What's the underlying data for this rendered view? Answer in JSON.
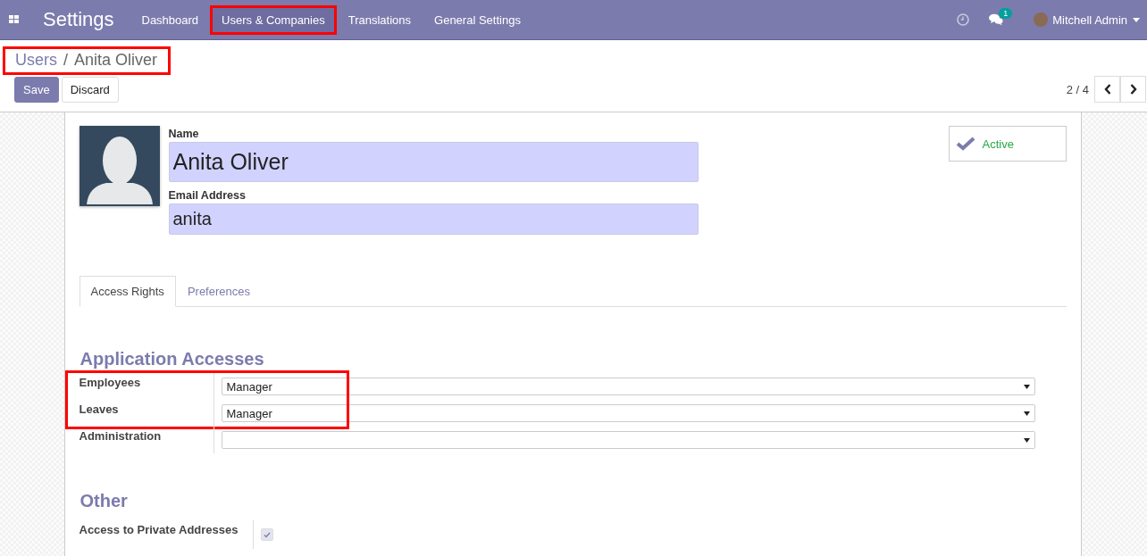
{
  "navbar": {
    "app_title": "Settings",
    "menu": [
      {
        "label": "Dashboard",
        "highlighted": false
      },
      {
        "label": "Users & Companies",
        "highlighted": true
      },
      {
        "label": "Translations",
        "highlighted": false
      },
      {
        "label": "General Settings",
        "highlighted": false
      }
    ],
    "messages_badge": "1",
    "user": "Mitchell Admin"
  },
  "breadcrumb": {
    "parent": "Users",
    "separator": "/",
    "current": "Anita Oliver",
    "highlighted": true
  },
  "buttons": [
    "Save",
    "Discard"
  ],
  "pager": "2 / 4",
  "form": {
    "name_label": "Name",
    "name": "Anita Oliver",
    "email_label": "Email Address",
    "email": "anita",
    "status": {
      "label": "Active",
      "on": true
    },
    "tabs": [
      {
        "label": "Access Rights",
        "selected": true
      },
      {
        "label": "Preferences",
        "selected": false
      }
    ],
    "application_accesses": {
      "title": "Application Accesses",
      "rows": [
        {
          "label": "Employees",
          "value": "Manager",
          "highlighted": true
        },
        {
          "label": "Leaves",
          "value": "Manager",
          "highlighted": true
        },
        {
          "label": "Administration",
          "highlighted": false
        }
      ]
    },
    "other": {
      "title": "Other",
      "rows": [
        {
          "label": "Access to Private Addresses",
          "checked": true
        }
      ]
    }
  }
}
